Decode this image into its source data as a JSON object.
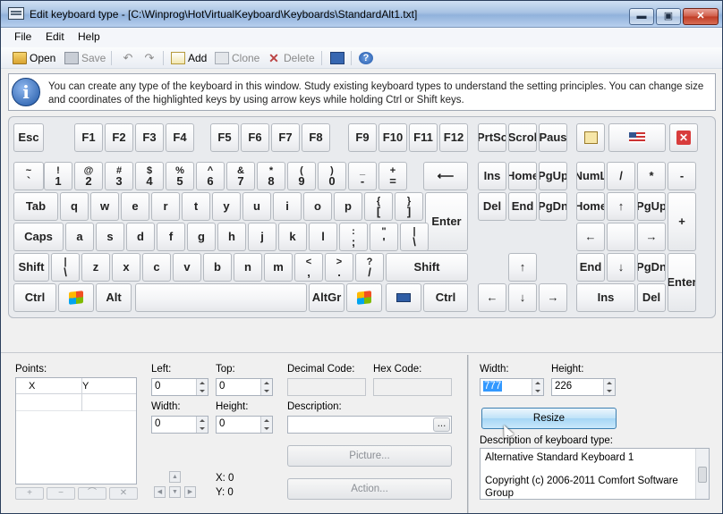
{
  "window": {
    "title": "Edit keyboard type - [C:\\Winprog\\HotVirtualKeyboard\\Keyboards\\StandardAlt1.txt]",
    "minimize": "▬",
    "maximize": "▣",
    "close": "✕"
  },
  "menu": {
    "file": "File",
    "edit": "Edit",
    "help": "Help"
  },
  "toolbar": {
    "open": "Open",
    "save": "Save",
    "undo": "↶",
    "redo": "↷",
    "add": "Add",
    "clone": "Clone",
    "delete": "Delete",
    "delete_icon": "✕",
    "help_icon": "?"
  },
  "info": {
    "icon": "i",
    "text": "You can create any type of the keyboard in this window. Study existing keyboard types to understand the setting principles. You can change size and coordinates of the highlighted keys by using arrow keys while holding Ctrl or Shift keys."
  },
  "keyboard": {
    "keys": [
      {
        "t": "",
        "b": "Esc"
      },
      {
        "t": "",
        "b": "F1"
      },
      {
        "t": "",
        "b": "F2"
      },
      {
        "t": "",
        "b": "F3"
      },
      {
        "t": "",
        "b": "F4"
      },
      {
        "t": "",
        "b": "F5"
      },
      {
        "t": "",
        "b": "F6"
      },
      {
        "t": "",
        "b": "F7"
      },
      {
        "t": "",
        "b": "F8"
      },
      {
        "t": "",
        "b": "F9"
      },
      {
        "t": "",
        "b": "F10"
      },
      {
        "t": "",
        "b": "F11"
      },
      {
        "t": "",
        "b": "F12"
      },
      {
        "t": "",
        "b": "PrtSc"
      },
      {
        "t": "",
        "b": "Scrol"
      },
      {
        "t": "",
        "b": "Paus"
      },
      {
        "icon": "note",
        "t": "",
        "b": ""
      },
      {
        "icon": "flag",
        "t": "",
        "b": ""
      },
      {
        "icon": "xred",
        "t": "",
        "b": "✕"
      },
      {
        "t": "~",
        "b": "`"
      },
      {
        "t": "!",
        "b": "1"
      },
      {
        "t": "@",
        "b": "2"
      },
      {
        "t": "#",
        "b": "3"
      },
      {
        "t": "$",
        "b": "4"
      },
      {
        "t": "%",
        "b": "5"
      },
      {
        "t": "^",
        "b": "6"
      },
      {
        "t": "&",
        "b": "7"
      },
      {
        "t": "*",
        "b": "8"
      },
      {
        "t": "(",
        "b": "9"
      },
      {
        "t": ")",
        "b": "0"
      },
      {
        "t": "_",
        "b": "-"
      },
      {
        "t": "+",
        "b": "="
      },
      {
        "t": "",
        "b": "⟵"
      },
      {
        "t": "",
        "b": "Ins"
      },
      {
        "t": "",
        "b": "Home"
      },
      {
        "t": "",
        "b": "PgUp"
      },
      {
        "t": "",
        "b": "NumL"
      },
      {
        "t": "",
        "b": "/"
      },
      {
        "t": "",
        "b": "*"
      },
      {
        "t": "",
        "b": "-"
      },
      {
        "t": "",
        "b": "Tab"
      },
      {
        "t": "",
        "b": "q"
      },
      {
        "t": "",
        "b": "w"
      },
      {
        "t": "",
        "b": "e"
      },
      {
        "t": "",
        "b": "r"
      },
      {
        "t": "",
        "b": "t"
      },
      {
        "t": "",
        "b": "y"
      },
      {
        "t": "",
        "b": "u"
      },
      {
        "t": "",
        "b": "i"
      },
      {
        "t": "",
        "b": "o"
      },
      {
        "t": "",
        "b": "p"
      },
      {
        "t": "{",
        "b": "["
      },
      {
        "t": "}",
        "b": "]"
      },
      {
        "t": "",
        "b": "Enter"
      },
      {
        "t": "",
        "b": "Del"
      },
      {
        "t": "",
        "b": "End"
      },
      {
        "t": "",
        "b": "PgDn"
      },
      {
        "t": "",
        "b": "Home"
      },
      {
        "t": "",
        "b": "↑"
      },
      {
        "t": "",
        "b": "PgUp"
      },
      {
        "t": "",
        "b": "+"
      },
      {
        "t": "",
        "b": "Caps"
      },
      {
        "t": "",
        "b": "a"
      },
      {
        "t": "",
        "b": "s"
      },
      {
        "t": "",
        "b": "d"
      },
      {
        "t": "",
        "b": "f"
      },
      {
        "t": "",
        "b": "g"
      },
      {
        "t": "",
        "b": "h"
      },
      {
        "t": "",
        "b": "j"
      },
      {
        "t": "",
        "b": "k"
      },
      {
        "t": "",
        "b": "l"
      },
      {
        "t": ":",
        "b": ";"
      },
      {
        "t": "\"",
        "b": "'"
      },
      {
        "t": "|",
        "b": "\\"
      },
      {
        "t": "",
        "b": "←"
      },
      {
        "t": "",
        "b": ""
      },
      {
        "t": "",
        "b": "→"
      },
      {
        "t": "",
        "b": "Shift"
      },
      {
        "t": "|",
        "b": "\\"
      },
      {
        "t": "",
        "b": "z"
      },
      {
        "t": "",
        "b": "x"
      },
      {
        "t": "",
        "b": "c"
      },
      {
        "t": "",
        "b": "v"
      },
      {
        "t": "",
        "b": "b"
      },
      {
        "t": "",
        "b": "n"
      },
      {
        "t": "",
        "b": "m"
      },
      {
        "t": "<",
        "b": ","
      },
      {
        "t": ">",
        "b": "."
      },
      {
        "t": "?",
        "b": "/"
      },
      {
        "t": "",
        "b": "Shift"
      },
      {
        "t": "",
        "b": "↑"
      },
      {
        "t": "",
        "b": "End"
      },
      {
        "t": "",
        "b": "↓"
      },
      {
        "t": "",
        "b": "PgDn"
      },
      {
        "t": "",
        "b": "Enter"
      },
      {
        "t": "",
        "b": "Ctrl"
      },
      {
        "icon": "win",
        "t": "",
        "b": ""
      },
      {
        "t": "",
        "b": "Alt"
      },
      {
        "t": "",
        "b": ""
      },
      {
        "t": "",
        "b": "AltGr"
      },
      {
        "icon": "win",
        "t": "",
        "b": ""
      },
      {
        "icon": "minikbd",
        "t": "",
        "b": ""
      },
      {
        "t": "",
        "b": "Ctrl"
      },
      {
        "t": "",
        "b": "←"
      },
      {
        "t": "",
        "b": "↓"
      },
      {
        "t": "",
        "b": "→"
      },
      {
        "t": "",
        "b": "Ins"
      },
      {
        "t": "",
        "b": "Del"
      }
    ]
  },
  "form": {
    "points_label": "Points:",
    "col_x": "X",
    "col_y": "Y",
    "left_label": "Left:",
    "left_value": "0",
    "top_label": "Top:",
    "top_value": "0",
    "width_label": "Width:",
    "width_value": "0",
    "height_label": "Height:",
    "height_value": "0",
    "decimal_code_label": "Decimal Code:",
    "hex_code_label": "Hex Code:",
    "description_label": "Description:",
    "description_value": "",
    "browse": "...",
    "picture_button": "Picture...",
    "action_button": "Action...",
    "x_readout": "X: 0",
    "y_readout": "Y: 0",
    "arrow_up": "▲",
    "arrow_left": "◀",
    "arrow_down": "▼",
    "arrow_right": "▶",
    "tool_buttons": [
      "+",
      "−",
      "⌒",
      "✕"
    ]
  },
  "kbtype": {
    "width_label": "Width:",
    "width_value": "777",
    "height_label": "Height:",
    "height_value": "226",
    "resize_button": "Resize",
    "desc_label": "Description of keyboard type:",
    "desc_line1": "Alternative Standard Keyboard 1",
    "desc_line2": "Copyright (c) 2006-2011  Comfort Software Group"
  }
}
